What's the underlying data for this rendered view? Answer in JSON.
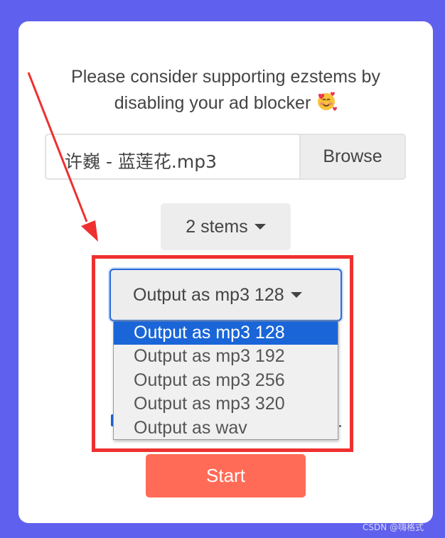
{
  "notice": {
    "line1": "Please consider supporting ezstems by",
    "line2": "disabling your ad blocker",
    "emoji_icon": "smiling-face-with-hearts-icon"
  },
  "file_input": {
    "value": "许巍 - 蓝莲花.mp3",
    "browse_label": "Browse"
  },
  "stems": {
    "selected": "2 stems"
  },
  "output": {
    "selected": "Output as mp3 128",
    "options": [
      "Output as mp3 128",
      "Output as mp3 192",
      "Output as mp3 256",
      "Output as mp3 320",
      "Output as wav"
    ]
  },
  "start_label": "Start",
  "watermark": "CSDN @嗨格式",
  "colors": {
    "background": "#6060ee",
    "start": "#ff6b57",
    "highlight": "#ee3030",
    "selection": "#1a66d8"
  }
}
